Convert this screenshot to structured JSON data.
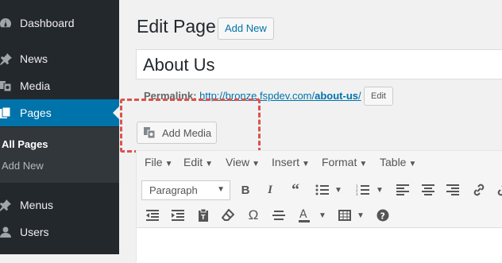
{
  "sidebar": {
    "items": [
      {
        "label": "Dashboard",
        "icon": "dashboard-icon"
      },
      {
        "label": "News",
        "icon": "pin-icon"
      },
      {
        "label": "Media",
        "icon": "media-icon"
      },
      {
        "label": "Pages",
        "icon": "pages-icon"
      },
      {
        "label": "Menus",
        "icon": "menus-icon"
      },
      {
        "label": "Users",
        "icon": "users-icon"
      }
    ],
    "submenu": [
      {
        "label": "All Pages"
      },
      {
        "label": "Add New"
      }
    ]
  },
  "header": {
    "title": "Edit Page",
    "add_new_label": "Add New"
  },
  "editor": {
    "title_value": "About Us",
    "permalink_label": "Permalink:",
    "permalink_url_base": "http://bronze.fspdev.com/",
    "permalink_slug": "about-us",
    "permalink_trailing": "/",
    "edit_label": "Edit",
    "add_media_label": "Add Media",
    "menubar": [
      "File",
      "Edit",
      "View",
      "Insert",
      "Format",
      "Table"
    ],
    "format_select": "Paragraph"
  },
  "colors": {
    "sidebar_bg": "#23282d",
    "accent": "#0073aa",
    "highlight": "#d9534f"
  }
}
